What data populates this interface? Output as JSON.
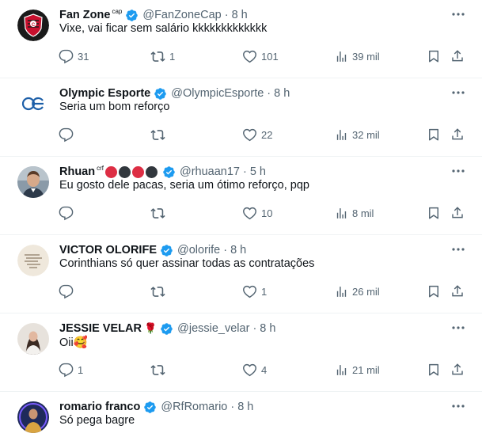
{
  "tweets": [
    {
      "name": "Fan Zone",
      "name_sup": "cap",
      "handle": "@FanZoneCap",
      "time": "8 h",
      "text": "Vixe, vai ficar sem salário kkkkkkkkkkkkk",
      "replies": "31",
      "retweets": "1",
      "likes": "101",
      "views": "39 mil",
      "avatar_icon": "club-crest-avatar"
    },
    {
      "name": "Olympic Esporte",
      "name_sup": "",
      "handle": "@OlympicEsporte",
      "time": "8 h",
      "text": "Seria um bom reforço",
      "replies": "",
      "retweets": "",
      "likes": "22",
      "views": "32 mil",
      "avatar_icon": "oe-logo-avatar"
    },
    {
      "name": "Rhuan",
      "name_sup": "crf",
      "handle": "@rhuaan17",
      "time": "5 h",
      "text": "Eu gosto dele pacas, seria um ótimo reforço, pqp",
      "replies": "",
      "retweets": "",
      "likes": "10",
      "views": "8 mil",
      "avatar_icon": "person-photo-avatar",
      "name_emojis": [
        "#dd2e44",
        "#31373d",
        "#dd2e44",
        "#31373d"
      ]
    },
    {
      "name": "VICTOR OLORIFE",
      "name_sup": "",
      "handle": "@olorife",
      "time": "8 h",
      "text": "Corinthians só quer assinar todas as contratações",
      "replies": "",
      "retweets": "",
      "likes": "1",
      "views": "26 mil",
      "avatar_icon": "handwritten-note-avatar"
    },
    {
      "name": "JESSIE VELAR",
      "name_sup": "",
      "handle": "@jessie_velar",
      "time": "8 h",
      "text": "Oii🥰",
      "replies": "1",
      "retweets": "",
      "likes": "4",
      "views": "21 mil",
      "avatar_icon": "person-photo-avatar",
      "name_emoji": "🌹"
    },
    {
      "name": "romario franco",
      "name_sup": "",
      "handle": "@RfRomario",
      "time": "8 h",
      "text": "Só pega bagre",
      "avatar_icon": "person-photo-avatar"
    }
  ],
  "colors": {
    "verified": "#1d9bf0",
    "secondary_text": "#536471",
    "primary_text": "#0f1419",
    "divider": "#eff3f4"
  },
  "icons": {
    "reply": "reply-icon",
    "retweet": "retweet-icon",
    "like": "heart-icon",
    "views": "views-icon",
    "bookmark": "bookmark-icon",
    "share": "share-icon",
    "more": "more-icon",
    "verified": "verified-badge-icon"
  }
}
